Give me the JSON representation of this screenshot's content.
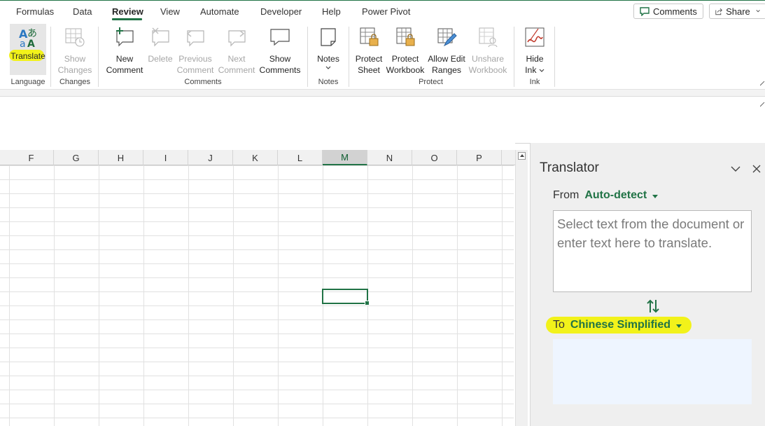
{
  "tabs": [
    {
      "label": "Formulas"
    },
    {
      "label": "Data"
    },
    {
      "label": "Review",
      "active": true
    },
    {
      "label": "View"
    },
    {
      "label": "Automate"
    },
    {
      "label": "Developer"
    },
    {
      "label": "Help"
    },
    {
      "label": "Power Pivot"
    }
  ],
  "top_buttons": {
    "comments": "Comments",
    "share": "Share"
  },
  "ribbon": {
    "language": {
      "label": "Language",
      "translate": "Translate"
    },
    "changes": {
      "label": "Changes",
      "show_changes_1": "Show",
      "show_changes_2": "Changes"
    },
    "comments": {
      "label": "Comments",
      "new_1": "New",
      "new_2": "Comment",
      "delete": "Delete",
      "previous_1": "Previous",
      "previous_2": "Comment",
      "next_1": "Next",
      "next_2": "Comment",
      "show_1": "Show",
      "show_2": "Comments"
    },
    "notes": {
      "label": "Notes",
      "notes": "Notes"
    },
    "protect": {
      "label": "Protect",
      "sheet_1": "Protect",
      "sheet_2": "Sheet",
      "workbook_1": "Protect",
      "workbook_2": "Workbook",
      "allow_1": "Allow Edit",
      "allow_2": "Ranges",
      "unshare_1": "Unshare",
      "unshare_2": "Workbook"
    },
    "ink": {
      "label": "Ink",
      "hide_1": "Hide",
      "hide_2": "Ink"
    }
  },
  "columns": [
    "F",
    "G",
    "H",
    "I",
    "J",
    "K",
    "L",
    "M",
    "N",
    "O",
    "P"
  ],
  "selected_column": "M",
  "translator": {
    "title": "Translator",
    "from_label": "From",
    "from_value": "Auto-detect",
    "source_placeholder": "Select text from the document or enter text here to translate.",
    "to_label": "To",
    "to_value": "Chinese Simplified"
  },
  "colors": {
    "accent": "#217346",
    "highlight": "#f2f21a",
    "target_bg": "#eef5ff"
  },
  "icons": [
    "translate-icon",
    "show-changes-icon",
    "new-comment-icon",
    "delete-comment-icon",
    "previous-comment-icon",
    "next-comment-icon",
    "show-comments-icon",
    "notes-icon",
    "protect-sheet-icon",
    "protect-workbook-icon",
    "allow-edit-ranges-icon",
    "unshare-workbook-icon",
    "hide-ink-icon",
    "comment-icon",
    "share-icon",
    "swap-languages-icon",
    "collapse-icon",
    "close-icon"
  ]
}
